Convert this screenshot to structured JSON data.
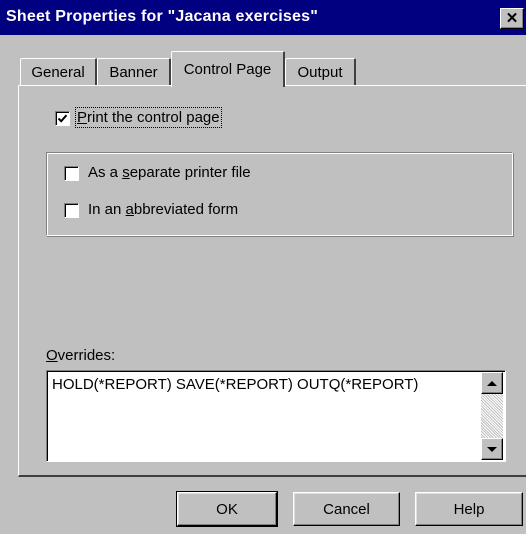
{
  "window": {
    "title": "Sheet Properties for \"Jacana exercises\"",
    "close_glyph": "✕"
  },
  "tabs": [
    {
      "label": "General",
      "active": false
    },
    {
      "label": "Banner",
      "active": false
    },
    {
      "label": "Control Page",
      "active": true
    },
    {
      "label": "Output",
      "active": false
    }
  ],
  "control_page": {
    "print_control_page": {
      "label_prefix": "",
      "mnemonic": "P",
      "label_rest": "rint the control page",
      "checked": true
    },
    "separate_printer_file": {
      "label_prefix": "As a ",
      "mnemonic": "s",
      "label_rest": "eparate printer file",
      "checked": false
    },
    "abbreviated_form": {
      "label_prefix": "In an ",
      "mnemonic": "a",
      "label_rest": "bbreviated form",
      "checked": false
    },
    "overrides": {
      "label_mnemonic": "O",
      "label_rest": "verrides:",
      "value": "HOLD(*REPORT) SAVE(*REPORT) OUTQ(*REPORT)"
    }
  },
  "buttons": {
    "ok": "OK",
    "cancel": "Cancel",
    "help": "Help"
  },
  "icons": {
    "checkbox_checked": "check-icon",
    "scroll_up": "arrow-up-icon",
    "scroll_down": "arrow-down-icon"
  },
  "colors": {
    "titlebar": "#000080",
    "face": "#c0c0c0"
  }
}
